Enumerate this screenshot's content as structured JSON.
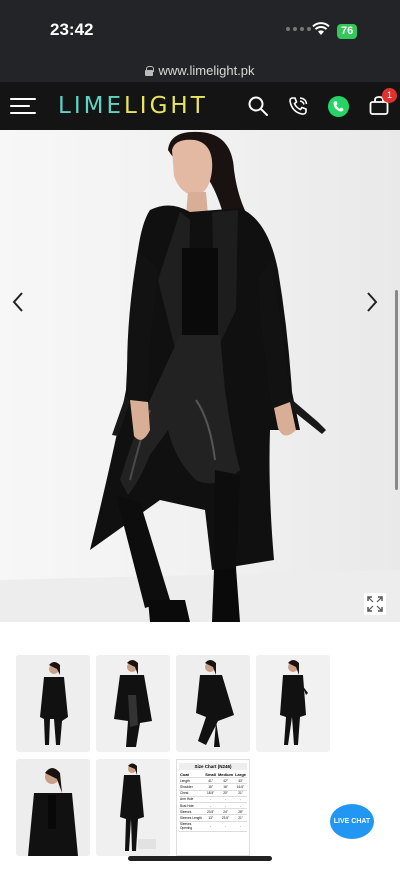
{
  "status": {
    "time": "23:42",
    "battery": "76"
  },
  "browser": {
    "url": "www.limelight.pk"
  },
  "header": {
    "logo_part1": "LIME",
    "logo_part2": "LIGHT",
    "cart_count": "1"
  },
  "size_chart": {
    "title": "Size Chart (N246)",
    "columns": [
      "Coat",
      "Small",
      "Medium",
      "Large"
    ],
    "rows": [
      [
        "Length",
        "41\"",
        "42\"",
        "43\""
      ],
      [
        "Shoulder",
        "15\"",
        "16\"",
        "16.5\""
      ],
      [
        "Chest",
        "18.5\"",
        "20\"",
        "21\""
      ],
      [
        "Arm Hole",
        "-",
        "-",
        "-"
      ],
      [
        "Bust Hole",
        "-",
        "-",
        "-"
      ],
      [
        "Sleeves",
        "23.5\"",
        "24\"",
        "28\""
      ],
      [
        "Sleeves Length",
        "13\"",
        "23.5\"",
        "21\""
      ],
      [
        "Sleeves Opening",
        "-",
        "-",
        "-"
      ]
    ]
  },
  "live_chat": {
    "label": "LIVE CHAT"
  },
  "colors": {
    "header_bg": "#141414",
    "logo_lime": "#5fd3c4",
    "logo_light": "#e8e65a",
    "whatsapp": "#25d366",
    "chat_bubble": "#2196f3",
    "badge": "#e0312f"
  }
}
